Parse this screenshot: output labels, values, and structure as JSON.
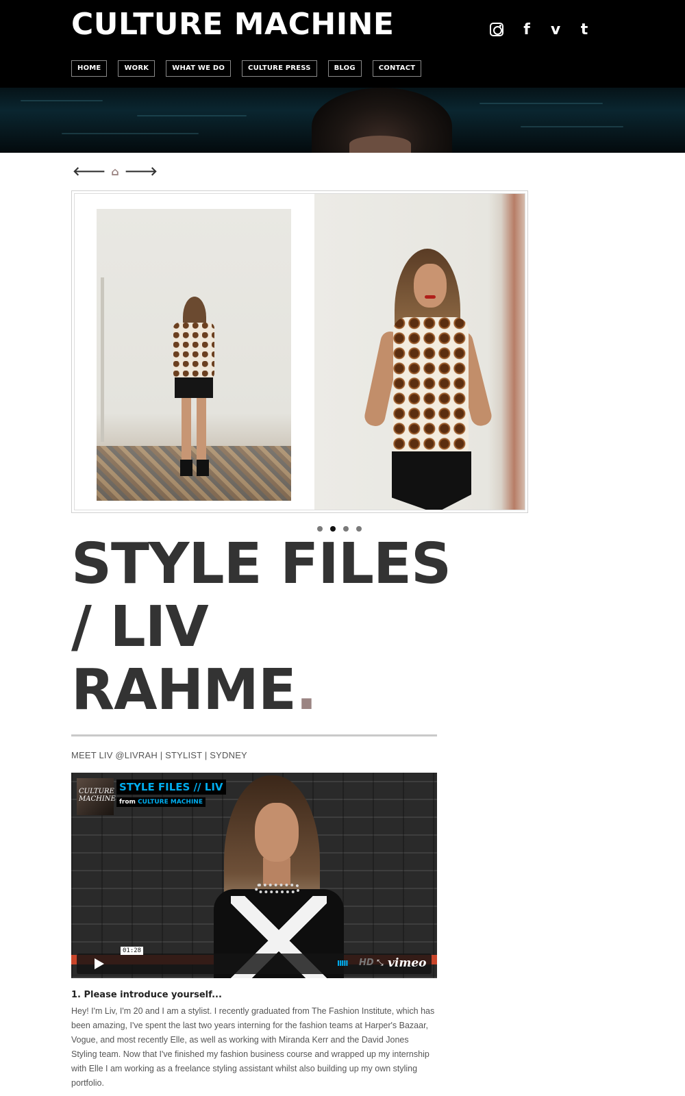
{
  "header": {
    "brand": "CULTURE MACHINE",
    "social": [
      {
        "name": "instagram-icon",
        "glyph": ""
      },
      {
        "name": "facebook-icon",
        "glyph": "f"
      },
      {
        "name": "vimeo-icon",
        "glyph": "v"
      },
      {
        "name": "tumblr-icon",
        "glyph": "t"
      }
    ],
    "nav": [
      "HOME",
      "WORK",
      "WHAT WE DO",
      "CULTURE PRESS",
      "BLOG",
      "CONTACT"
    ]
  },
  "post_nav": {
    "prev_glyph": "🡐",
    "home_glyph": "⌂",
    "next_glyph": "🡒"
  },
  "slider": {
    "slides": 4,
    "active_index": 1
  },
  "post": {
    "title": "STYLE FILES / LIV RAHME",
    "title_period": ".",
    "subtitle": "MEET LIV @LIVRAH | STYLIST | SYDNEY"
  },
  "video": {
    "logo_text": "CULTURE MACHINE",
    "title": "STYLE FILES // LIV",
    "from_label": "from",
    "from_channel": "CULTURE MACHINE",
    "time": "01:28",
    "volume_glyph": "IIIII",
    "hd_label": "HD",
    "fullscreen_glyph": "⤡",
    "brand": "vimeo"
  },
  "content": {
    "question": "1. Please introduce yourself...",
    "answer": "Hey! I'm Liv, I'm 20 and I am a stylist. I recently graduated from The Fashion Institute, which has been amazing, I've spent the last two years interning for the fashion teams at Harper's Bazaar, Vogue, and most recently Elle, as well as working with Miranda Kerr and the David Jones Styling team. Now that I've finished my fashion business course and wrapped up my internship with Elle I am working as a freelance styling assistant whilst also building up my own styling portfolio."
  }
}
